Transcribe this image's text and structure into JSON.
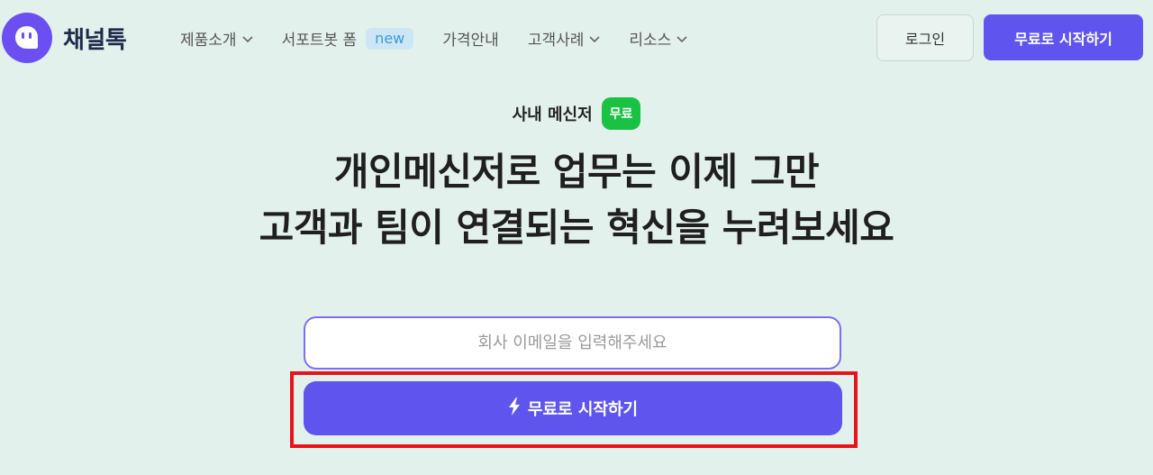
{
  "header": {
    "brand": "채널톡",
    "nav": [
      {
        "label": "제품소개",
        "has_dropdown": true
      },
      {
        "label": "서포트봇 폼",
        "badge": "new"
      },
      {
        "label": "가격안내"
      },
      {
        "label": "고객사례",
        "has_dropdown": true
      },
      {
        "label": "리소스",
        "has_dropdown": true
      }
    ],
    "login_label": "로그인",
    "start_label": "무료로 시작하기"
  },
  "hero": {
    "eyebrow": "사내 메신저",
    "eyebrow_badge": "무료",
    "headline_line1": "개인메신저로 업무는 이제 그만",
    "headline_line2": "고객과 팀이 연결되는 혁신을 누려보세요"
  },
  "form": {
    "email_placeholder": "회사 이메일을 입력해주세요",
    "submit_label": "무료로 시작하기",
    "submit_icon": "lightning-icon"
  },
  "colors": {
    "accent": "#5f55ee",
    "background": "#e3f1ec",
    "free_badge": "#19c242",
    "highlight": "#e8141b"
  }
}
